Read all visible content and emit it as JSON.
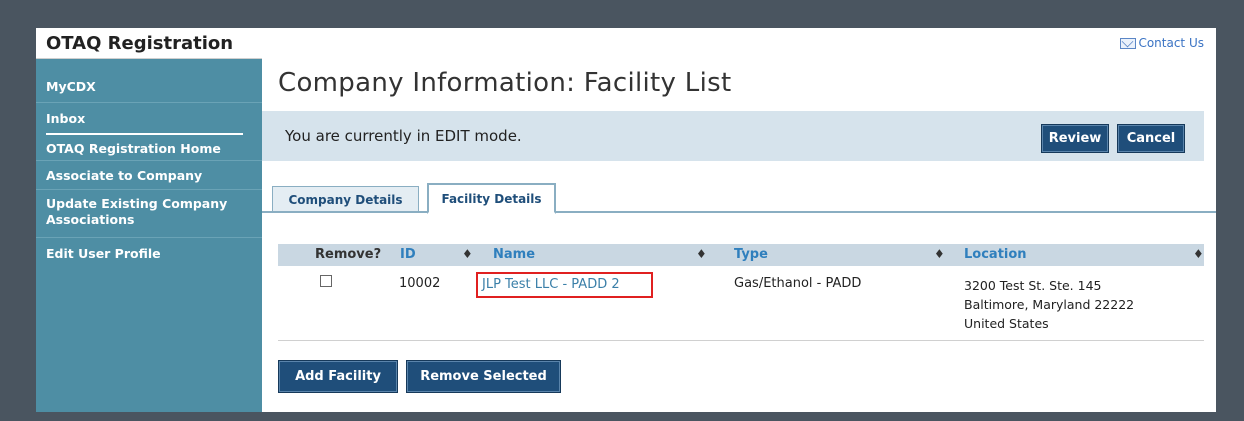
{
  "app": {
    "title": "OTAQ Registration",
    "contact_label": "Contact Us"
  },
  "sidebar": {
    "items": [
      {
        "label": "MyCDX"
      },
      {
        "label": "Inbox"
      },
      {
        "label": "OTAQ Registration Home"
      },
      {
        "label": "Associate to Company"
      },
      {
        "label": "Update Existing Company Associations"
      },
      {
        "label": "Edit User Profile"
      }
    ]
  },
  "page": {
    "title": "Company Information: Facility List",
    "mode_text": "You are currently in EDIT mode.",
    "review_label": "Review",
    "cancel_label": "Cancel"
  },
  "tabs": [
    {
      "label": "Company Details",
      "active": false
    },
    {
      "label": "Facility Details",
      "active": true
    }
  ],
  "table": {
    "headers": {
      "remove": "Remove?",
      "id": "ID",
      "name": "Name",
      "type": "Type",
      "location": "Location"
    },
    "sort_glyph": "♦",
    "rows": [
      {
        "checked": false,
        "id": "10002",
        "name": "JLP Test LLC - PADD 2",
        "type": "Gas/Ethanol - PADD",
        "location_line1": "3200 Test St. Ste. 145",
        "location_line2": "Baltimore, Maryland 22222",
        "location_line3": "United States"
      }
    ]
  },
  "actions": {
    "add_label": "Add Facility",
    "remove_label": "Remove Selected"
  },
  "colors": {
    "sidebar": "#4e8ea4",
    "button": "#1f4e7a",
    "highlight": "#e02020",
    "link": "#2f7fbd"
  }
}
